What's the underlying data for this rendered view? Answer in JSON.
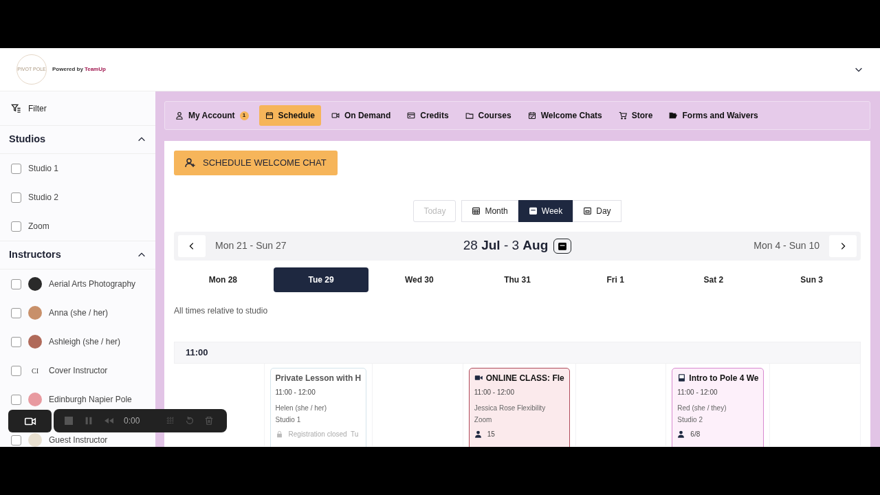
{
  "header": {
    "logo_text": "PIVOT POLE",
    "powered_by": "Powered by",
    "brand": "TeamUp"
  },
  "nav_tabs": [
    {
      "label": "My Account",
      "badge": "1",
      "selected": false
    },
    {
      "label": "Schedule",
      "selected": true
    },
    {
      "label": "On Demand",
      "selected": false
    },
    {
      "label": "Credits",
      "selected": false
    },
    {
      "label": "Courses",
      "selected": false
    },
    {
      "label": "Welcome Chats",
      "selected": false
    },
    {
      "label": "Store",
      "selected": false
    },
    {
      "label": "Forms and Waivers",
      "selected": false
    }
  ],
  "sidebar": {
    "filter_label": "Filter",
    "sections": [
      {
        "title": "Studios",
        "expanded": true,
        "items": [
          {
            "label": "Studio 1",
            "checked": false
          },
          {
            "label": "Studio 2",
            "checked": false
          },
          {
            "label": "Zoom",
            "checked": false
          }
        ]
      },
      {
        "title": "Instructors",
        "expanded": true,
        "items": [
          {
            "label": "Aerial Arts Photography",
            "checked": false,
            "color": "#2a2a2a"
          },
          {
            "label": "Anna (she / her)",
            "checked": false,
            "color": "#c8906a"
          },
          {
            "label": "Ashleigh (she / her)",
            "checked": false,
            "color": "#b06a5a"
          },
          {
            "label": "Cover Instructor",
            "checked": false,
            "initials": "CI"
          },
          {
            "label": "Edinburgh Napier Pole",
            "checked": false,
            "color": "#e89aa0"
          },
          {
            "label": "Guest Instructor",
            "checked": false,
            "color": "#e8e0d0"
          }
        ]
      }
    ]
  },
  "action_button": "SCHEDULE WELCOME CHAT",
  "views": [
    {
      "label": "Today",
      "kind": "today",
      "disabled": true,
      "selected": false
    },
    {
      "label": "Month",
      "kind": "month",
      "selected": false
    },
    {
      "label": "Week",
      "kind": "week",
      "selected": true
    },
    {
      "label": "Day",
      "kind": "day",
      "selected": false
    }
  ],
  "week_nav": {
    "previous": "Mon 21 - Sun 27",
    "current": "28 **Jul** - 3 **Aug**",
    "next": "Mon 4 - Sun 10"
  },
  "days": [
    {
      "label": "Mon 28",
      "selected": false
    },
    {
      "label": "Tue 29",
      "selected": true,
      "events": [
        {
          "kind": "lesson",
          "color": "#d4e4ec",
          "title": "Private Lesson with H",
          "time": "11:00 - 12:00",
          "instructor": "Helen (she / her)",
          "location": "Studio 1",
          "status": "Registration closed  Tu"
        }
      ]
    },
    {
      "label": "Wed 30",
      "selected": false
    },
    {
      "label": "Thu 31",
      "selected": false,
      "events": [
        {
          "kind": "online",
          "color": "#b04a5a",
          "title": "ONLINE CLASS: Fle",
          "time": "11:00 - 12:00",
          "instructor": "Jessica Rose Flexibility",
          "location": "Zoom",
          "attendance": "15"
        }
      ]
    },
    {
      "label": "Fri 1",
      "selected": false
    },
    {
      "label": "Sat 2",
      "selected": false,
      "events": [
        {
          "kind": "course",
          "color": "#d88ad0",
          "title": "Intro to Pole 4 We",
          "time": "11:00 - 12:00",
          "instructor": "Red (she / they)",
          "location": "Studio 2",
          "attendance": "6/8"
        }
      ]
    },
    {
      "label": "Sun 3",
      "selected": false
    }
  ],
  "timezone_note": "All times relative to studio",
  "time_slot": "11:00",
  "recorder": {
    "time": "0:00"
  }
}
